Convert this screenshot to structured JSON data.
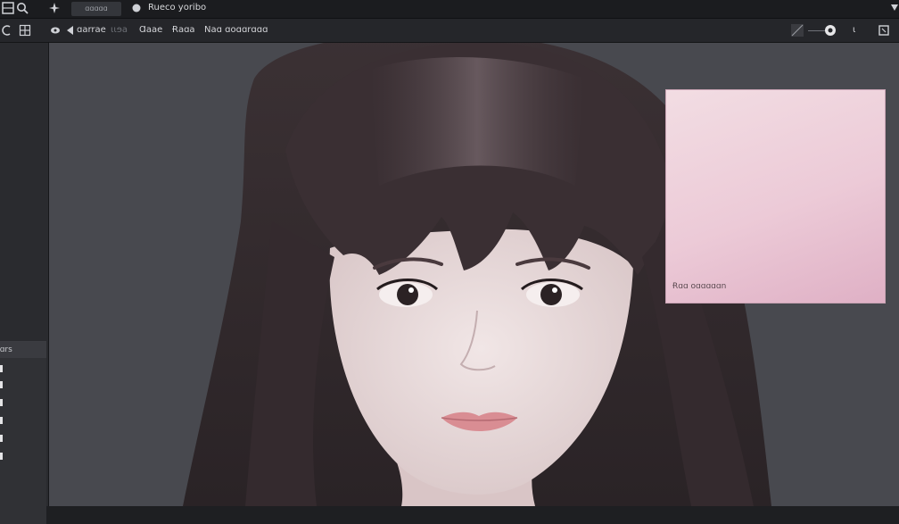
{
  "topbar": {
    "tab_label": "ɑɑɑɑɑ",
    "document_title": "Rueco yoribo"
  },
  "toolbar": {
    "items": [
      "ɑarrae",
      "ɩɩɘa",
      "Ɑaae",
      "Ɍaɑa",
      "Naɑ ɑoɑɑrɑɑɑ"
    ],
    "right_text": "ɩ"
  },
  "layers": {
    "header": "ɑɑrs"
  },
  "note": {
    "text": "Ɍɑɑ oɑɑɑɑɑn"
  },
  "colors": {
    "accent": "#e8c7d3",
    "canvas": "#48494f"
  }
}
